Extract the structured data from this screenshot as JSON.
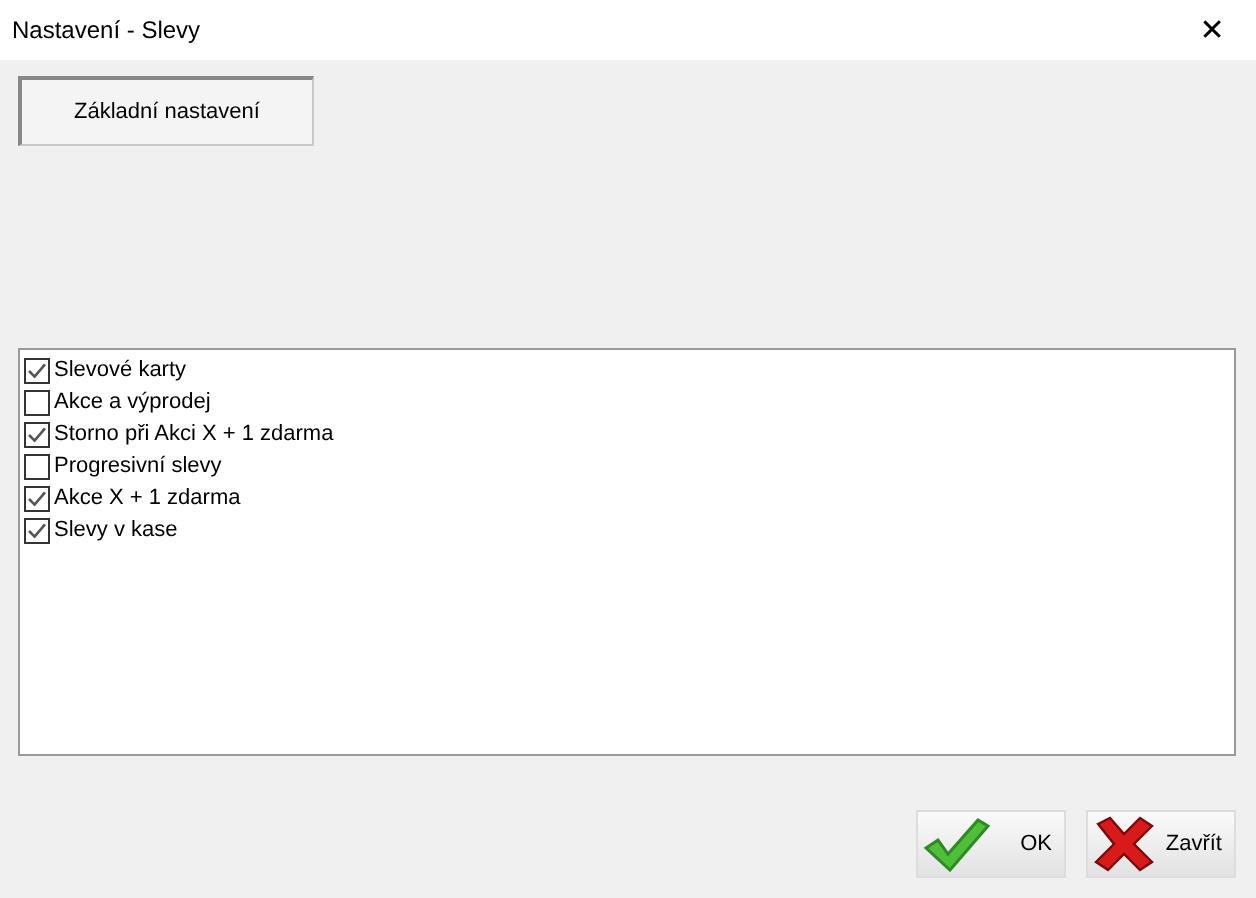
{
  "window": {
    "title": "Nastavení - Slevy",
    "close": "✕"
  },
  "tab_button": "Základní nastavení",
  "items": [
    {
      "label": "Slevové karty",
      "checked": true
    },
    {
      "label": "Akce a výprodej",
      "checked": false
    },
    {
      "label": "Storno při Akci X + 1 zdarma",
      "checked": true
    },
    {
      "label": "Progresivní slevy",
      "checked": false
    },
    {
      "label": "Akce X + 1 zdarma",
      "checked": true
    },
    {
      "label": "Slevy v kase",
      "checked": true
    }
  ],
  "buttons": [
    {
      "kind": "ok",
      "label": "OK"
    },
    {
      "kind": "close",
      "label": "Zavřít"
    }
  ]
}
